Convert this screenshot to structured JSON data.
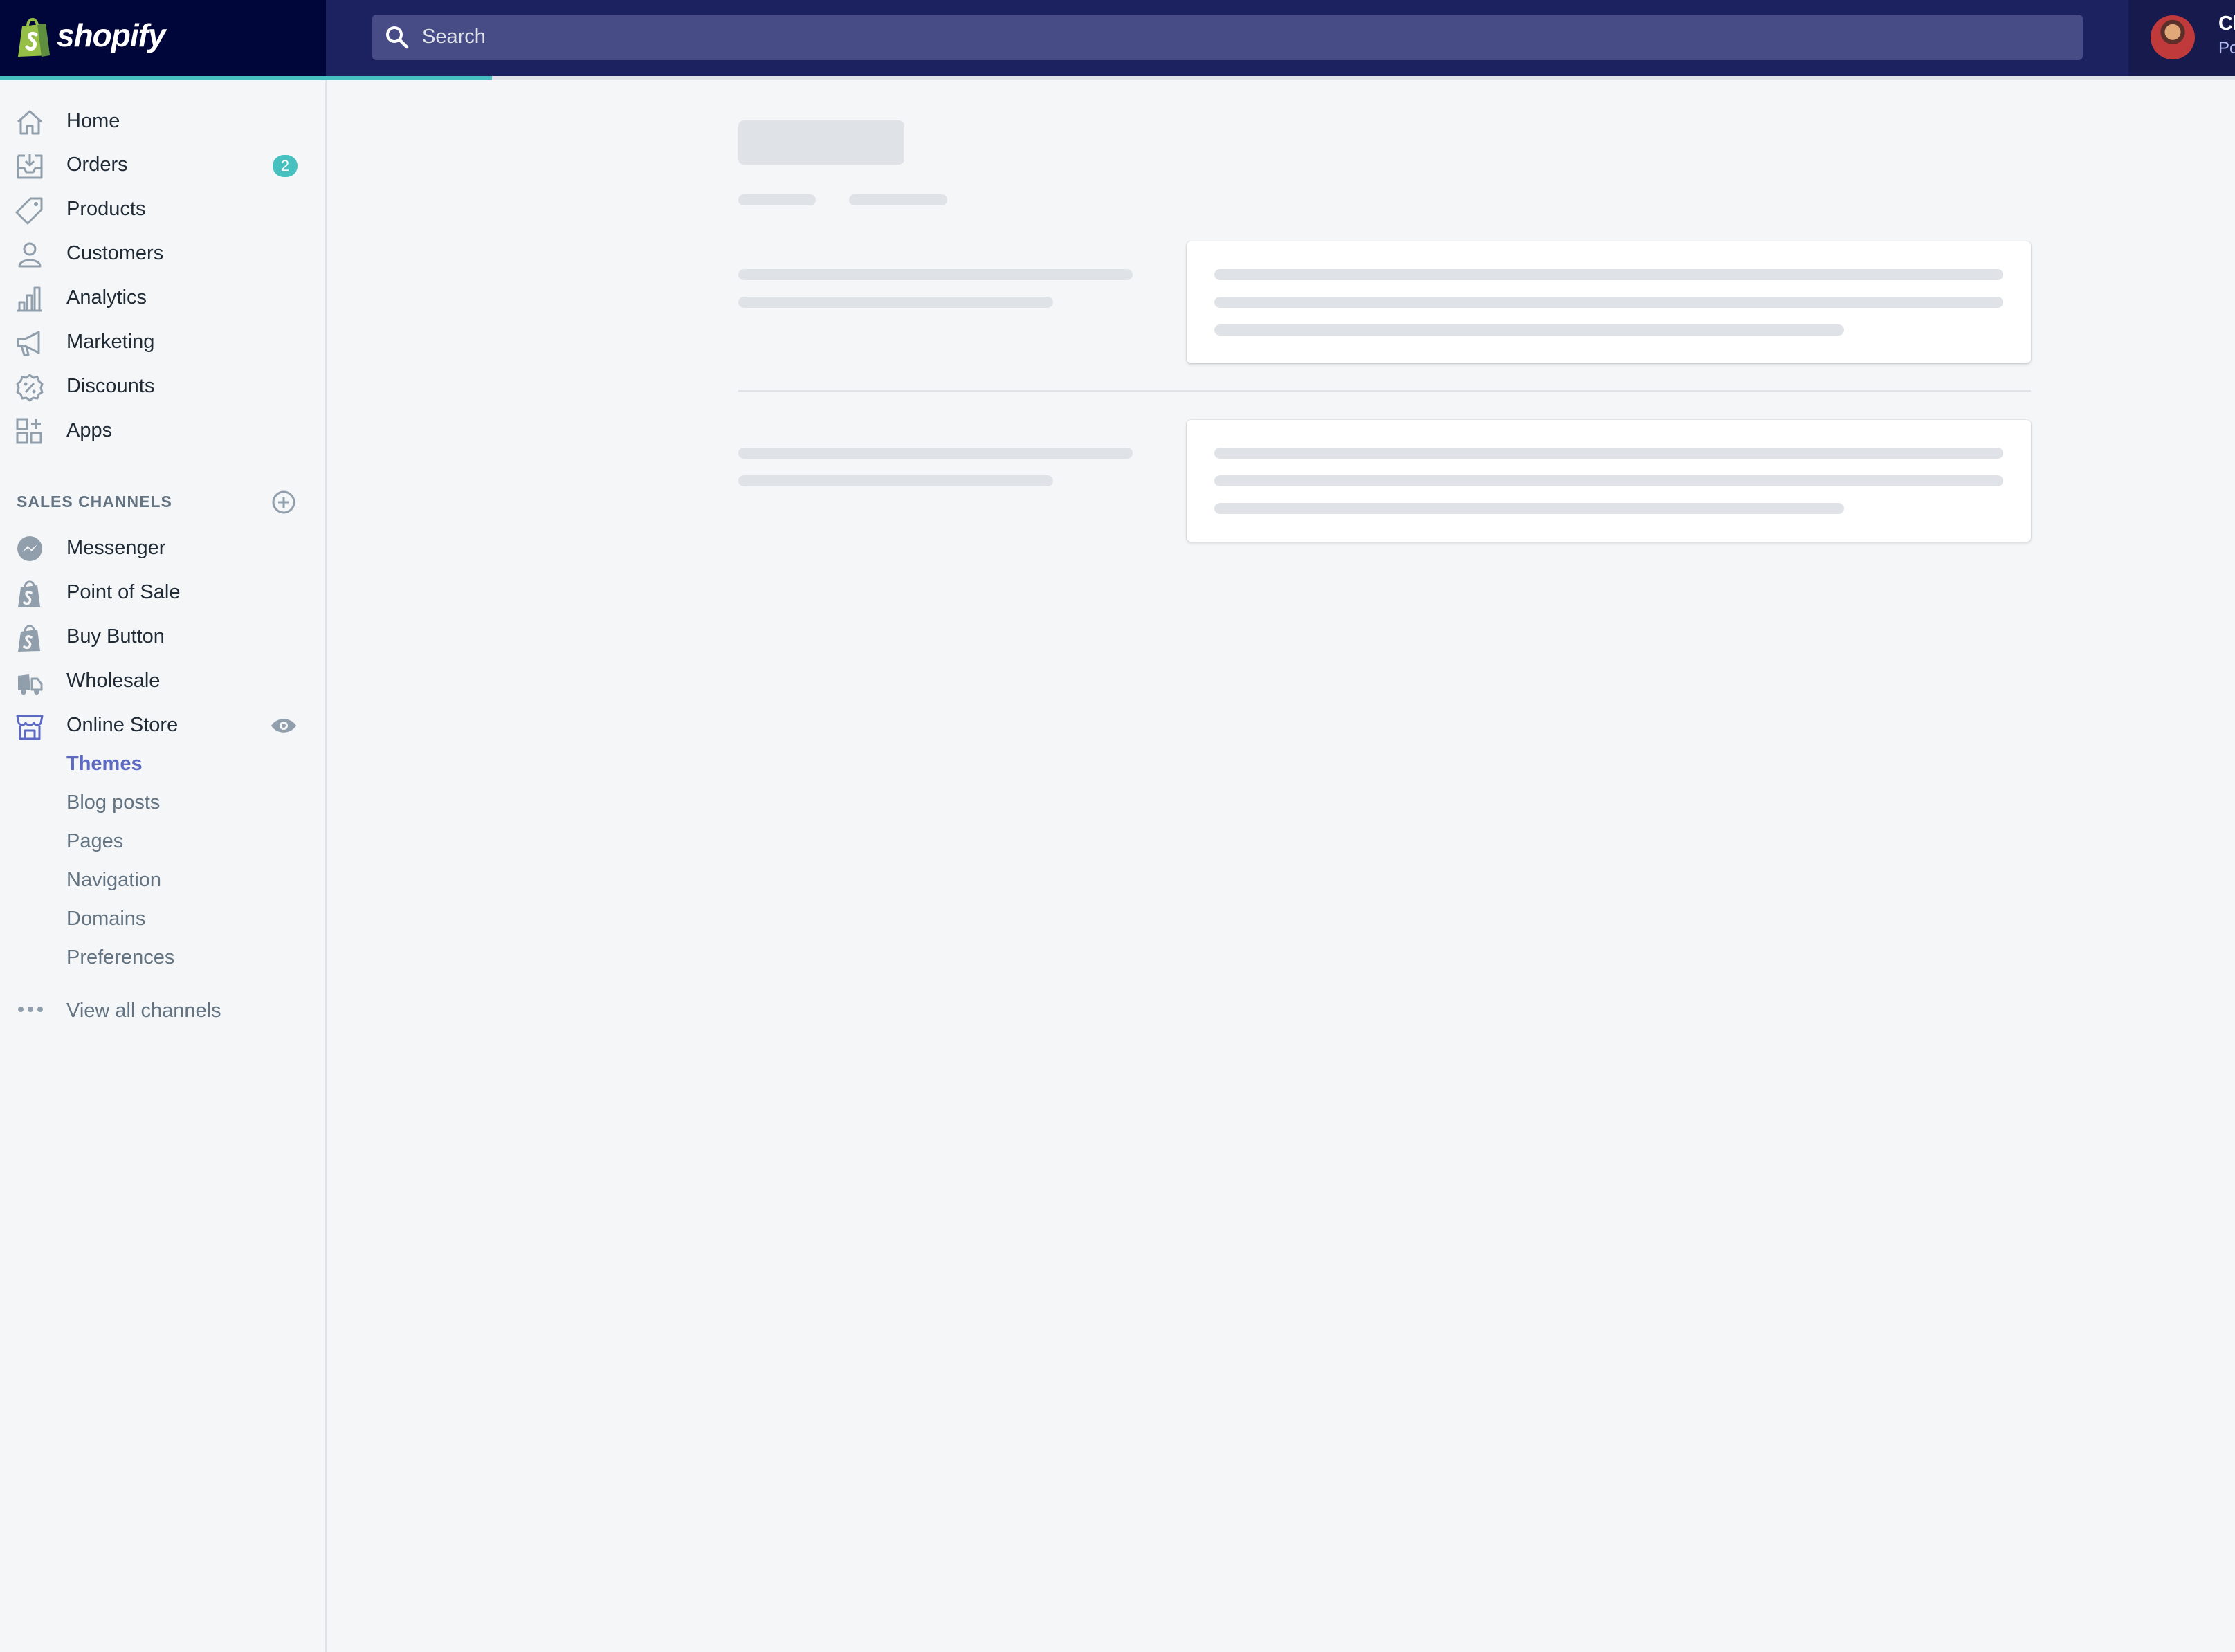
{
  "topbar": {
    "logo_text": "shopify",
    "search_placeholder": "Search",
    "account_name": "Cl",
    "account_sub": "Po"
  },
  "progress": {
    "fraction": 0.22
  },
  "sidebar": {
    "items": [
      {
        "label": "Home",
        "icon": "home-icon"
      },
      {
        "label": "Orders",
        "icon": "orders-icon",
        "badge": "2"
      },
      {
        "label": "Products",
        "icon": "tag-icon"
      },
      {
        "label": "Customers",
        "icon": "person-icon"
      },
      {
        "label": "Analytics",
        "icon": "bar-chart-icon"
      },
      {
        "label": "Marketing",
        "icon": "megaphone-icon"
      },
      {
        "label": "Discounts",
        "icon": "discount-icon"
      },
      {
        "label": "Apps",
        "icon": "apps-icon"
      }
    ],
    "sales_channels_title": "SALES CHANNELS",
    "channels": [
      {
        "label": "Messenger",
        "icon": "messenger-icon"
      },
      {
        "label": "Point of Sale",
        "icon": "shopping-bag-icon"
      },
      {
        "label": "Buy Button",
        "icon": "shopping-bag-icon"
      },
      {
        "label": "Wholesale",
        "icon": "truck-icon"
      },
      {
        "label": "Online Store",
        "icon": "store-icon"
      }
    ],
    "online_store_subitems": [
      {
        "label": "Themes",
        "active": true
      },
      {
        "label": "Blog posts"
      },
      {
        "label": "Pages"
      },
      {
        "label": "Navigation"
      },
      {
        "label": "Domains"
      },
      {
        "label": "Preferences"
      }
    ],
    "view_all_label": "View all channels"
  },
  "colors": {
    "topbar": "#1c2260",
    "logo_bg": "#000639",
    "search_bg": "#474c86",
    "accent_teal": "#47c1bf",
    "active_indigo": "#5c6ac4",
    "skeleton": "#dfe3e8"
  }
}
